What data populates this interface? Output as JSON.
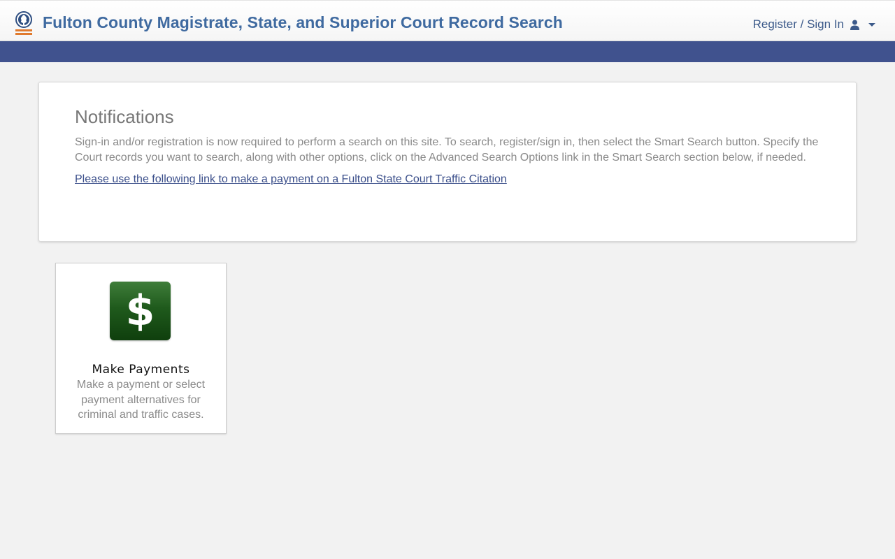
{
  "header": {
    "logo_icon": "fulton-county-logo-icon",
    "title": "Fulton County Magistrate, State, and Superior Court Record Search",
    "user_menu_label": "Register / Sign In",
    "user_icon": "user-icon",
    "caret_icon": "caret-down-icon",
    "title_color": "#3f6aa0",
    "nav_bar_color": "#40528e"
  },
  "notifications": {
    "title": "Notifications",
    "text": "Sign-in and/or registration is now required to perform a search on this site. To search, register/sign in, then select the Smart Search button. Specify the Court records you want to search, along with other options, click on the Advanced Search Options link in the Smart Search section below, if needed.",
    "link": "Please use the following link to make a payment on a Fulton State Court Traffic Citation"
  },
  "tiles": [
    {
      "icon": "dollar-icon",
      "icon_glyph": "$",
      "title": "Make Payments",
      "description": "Make a payment or select payment alternatives for criminal and traffic cases."
    }
  ]
}
